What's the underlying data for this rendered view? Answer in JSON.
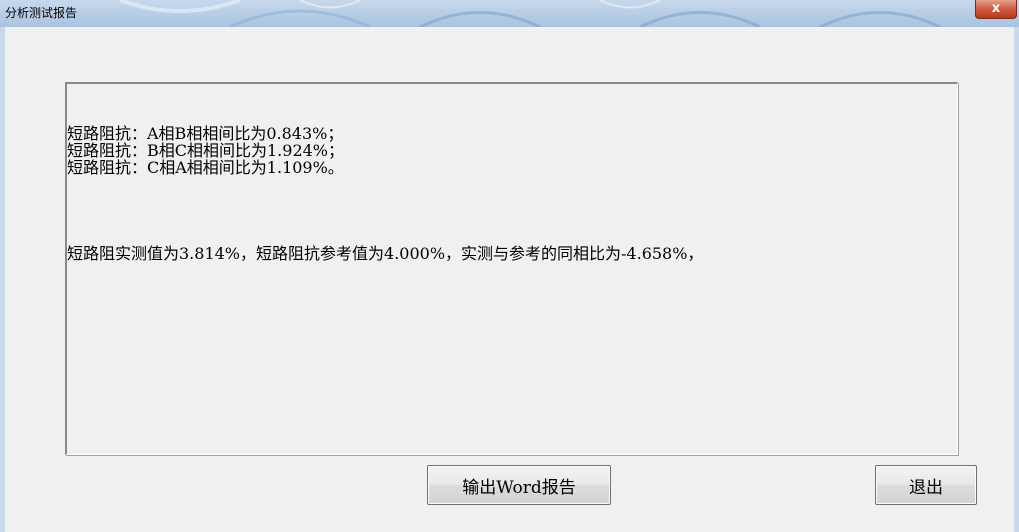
{
  "window": {
    "title": "分析测试报告",
    "close_glyph": "x"
  },
  "report": {
    "lines": [
      "短路阻抗：A相B相相间比为0.843%；",
      "短路阻抗：B相C相相间比为1.924%；",
      "短路阻抗：C相A相相间比为1.109%。",
      "短路阻实测值为3.814%，短路阻抗参考值为4.000%，实测与参考的同相比为-4.658%，"
    ]
  },
  "buttons": {
    "export_label": "输出Word报告",
    "exit_label": "退出"
  }
}
